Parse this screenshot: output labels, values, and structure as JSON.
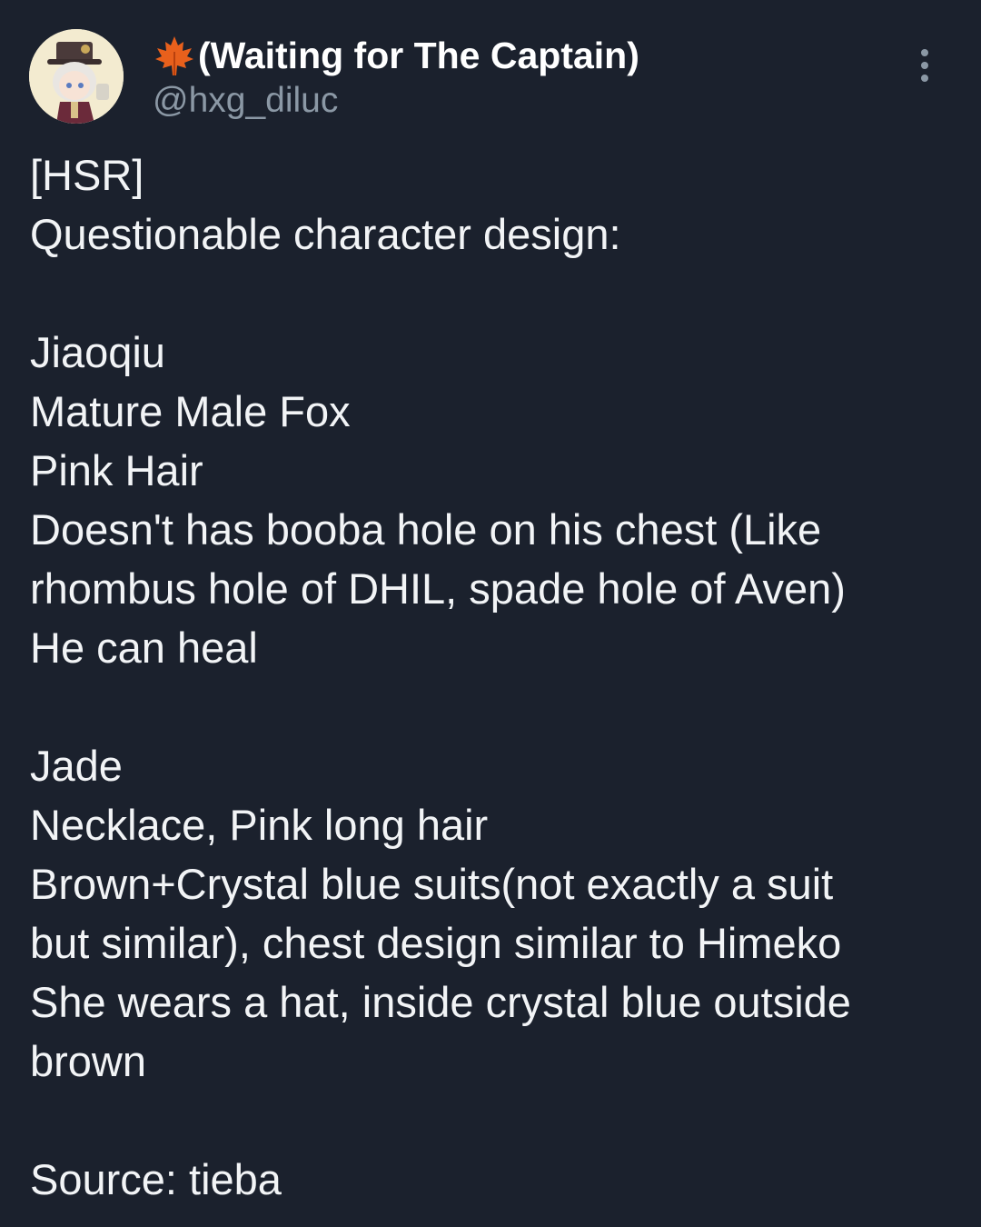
{
  "author": {
    "display_name": "(Waiting for The Captain)",
    "handle": "@hxg_diluc",
    "emoji": "maple-leaf-icon"
  },
  "post": {
    "lines": [
      "[HSR]",
      "Questionable character design:",
      "",
      "Jiaoqiu",
      "Mature Male Fox",
      "Pink Hair",
      "Doesn't has booba hole on his chest (Like",
      "rhombus hole of DHIL, spade hole of Aven)",
      "He can heal",
      "",
      "Jade",
      "Necklace, Pink long hair",
      "Brown+Crystal blue suits(not exactly a suit",
      "but similar), chest design similar to Himeko",
      "She wears a hat, inside crystal blue outside",
      "brown",
      "",
      "Source: tieba"
    ]
  },
  "colors": {
    "background": "#1b212d",
    "text": "#f2f4f6",
    "muted": "#8b98a5",
    "maple": "#e8601c"
  }
}
